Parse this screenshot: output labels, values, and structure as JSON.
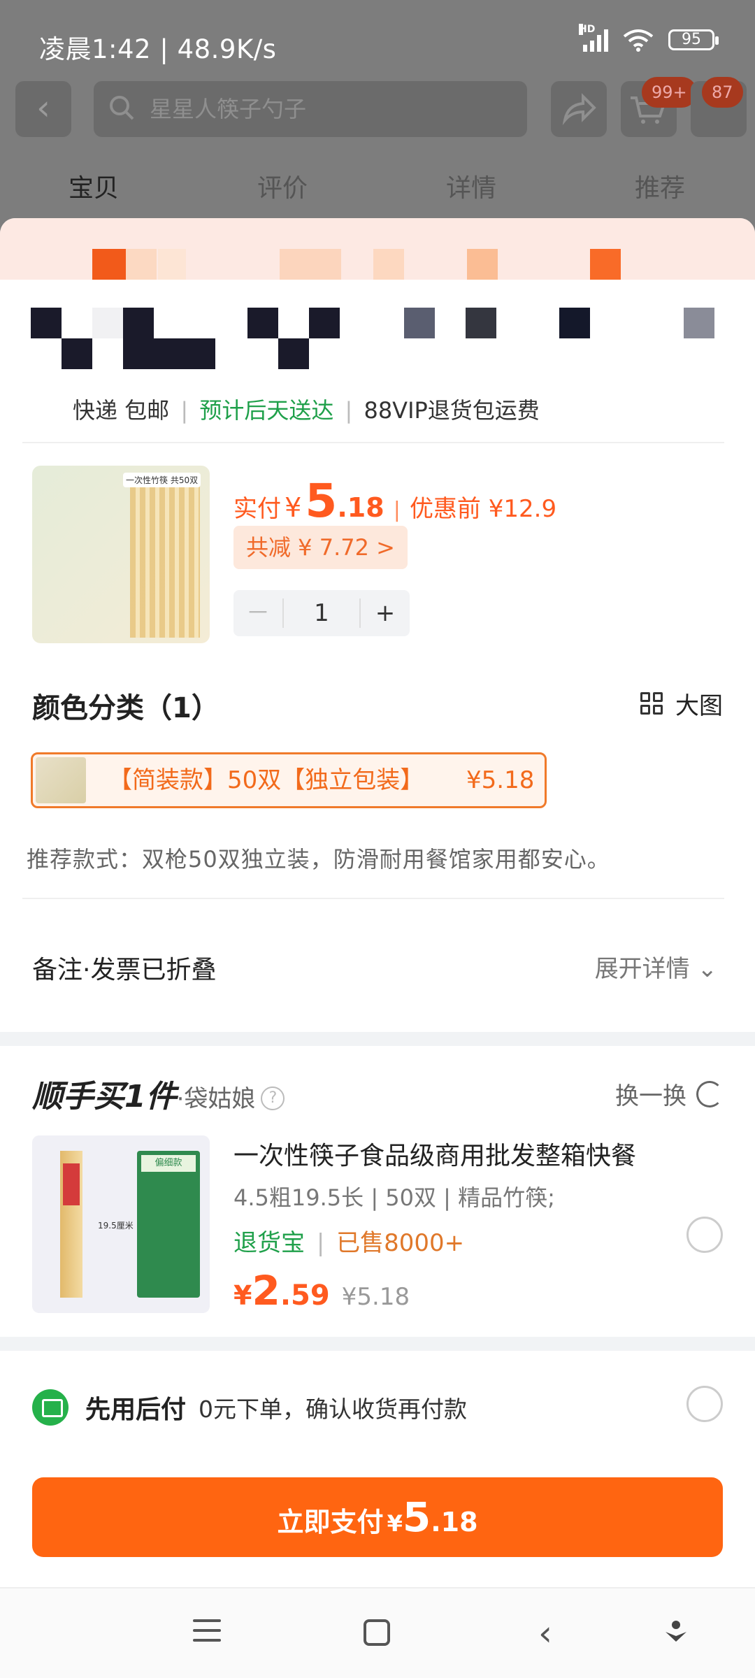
{
  "status_bar": {
    "time": "凌晨1:42 | 48.9K/s",
    "network": "HD",
    "battery": "95"
  },
  "nav": {
    "search_placeholder": "星星人筷子勺子",
    "cart_badge": "99+",
    "msg_badge": "87"
  },
  "tabs": [
    "宝贝",
    "评价",
    "详情",
    "推荐"
  ],
  "shipping": {
    "method": "快递 包邮",
    "delivery": "预计后天送达",
    "return": "88VIP退货包运费"
  },
  "product": {
    "img_label": "一次性竹筷",
    "img_count": "共50双",
    "price_label": "实付",
    "currency": "¥",
    "price_int": "5",
    "price_dec": ".18",
    "before_price": "优惠前 ¥12.9",
    "discount": "共减 ¥ 7.72 >",
    "qty": "1",
    "minus": "－",
    "plus": "+"
  },
  "variants": {
    "title": "颜色分类（1）",
    "big_view": "大图",
    "selected_text": "【简装款】50双【独立包装】",
    "selected_price": "¥5.18",
    "recommend": "推荐款式：双枪50双独立装，防滑耐用餐馆家用都安心。"
  },
  "note": {
    "label": "备注·发票已折叠",
    "expand": "展开详情"
  },
  "bundle": {
    "title": "顺手买1件",
    "shop": "·袋姑娘",
    "help": "?",
    "swap": "换一换",
    "name": "一次性筷子食品级商用批发整箱快餐",
    "spec": "4.5粗19.5长 | 50双 | 精品竹筷;",
    "tag_return": "退货宝",
    "tag_sold": "已售8000+",
    "currency": "¥",
    "price_int": "2",
    "price_dec": ".59",
    "orig_price": "¥5.18",
    "img_box_label": "偏细款",
    "img_dim": "19.5厘米"
  },
  "pay_later": {
    "title": "先用后付",
    "desc": "0元下单，确认收货再付款"
  },
  "pay_button": {
    "label": "立即支付",
    "currency": "¥",
    "price_int": "5",
    "price_dec": ".18"
  },
  "colors": {
    "accent": "#ff6511",
    "price": "#ff5a1f",
    "green": "#1fa04a"
  }
}
